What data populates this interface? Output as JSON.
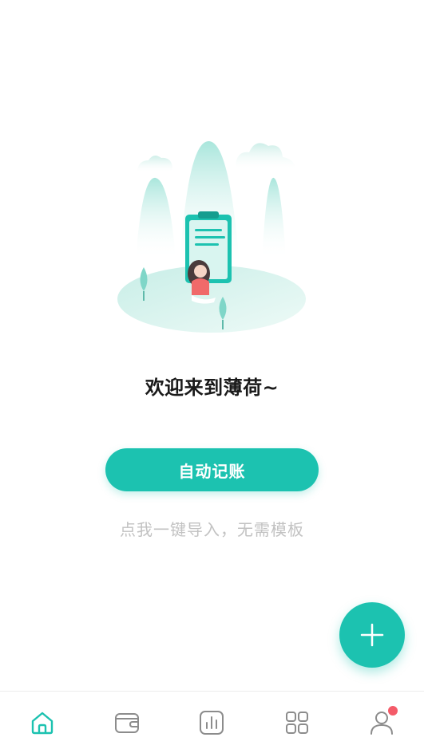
{
  "welcome": {
    "title": "欢迎来到薄荷~"
  },
  "auto_bookkeeping": {
    "button_label": "自动记账",
    "hint": "点我一键导入，无需模板"
  },
  "fab": {
    "icon": "plus-icon"
  },
  "tabbar": {
    "items": [
      {
        "icon": "home-icon",
        "active": true
      },
      {
        "icon": "wallet-icon",
        "active": false
      },
      {
        "icon": "chart-icon",
        "active": false
      },
      {
        "icon": "apps-grid-icon",
        "active": false
      },
      {
        "icon": "user-icon",
        "active": false,
        "badge": true
      }
    ]
  },
  "colors": {
    "accent": "#1cc2b0",
    "inactive_icon": "#8c8c8c",
    "badge": "#f45b69",
    "hint_text": "#c2c2c2"
  }
}
